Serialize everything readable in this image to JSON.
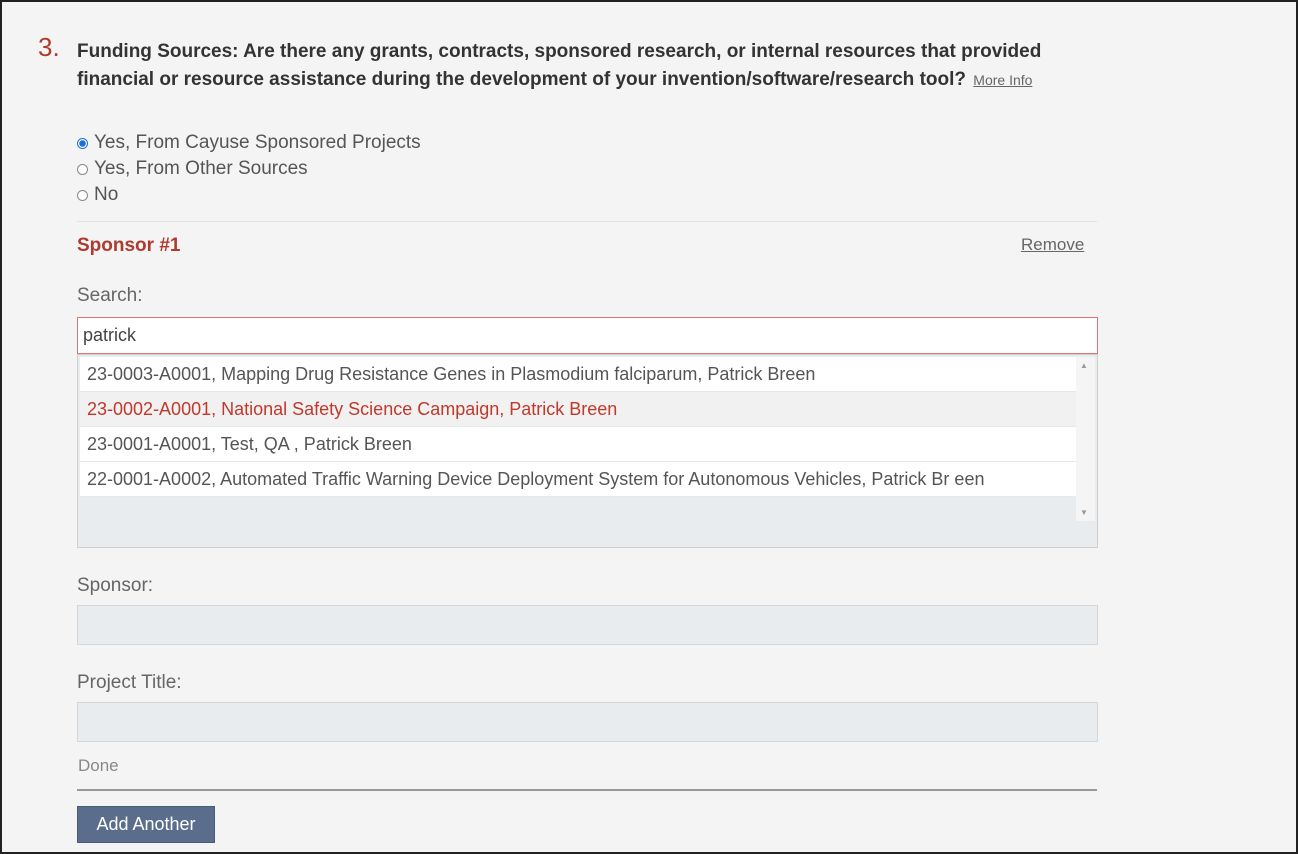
{
  "question": {
    "number": "3.",
    "text": "Funding Sources: Are there any grants, contracts, sponsored research, or internal resources that provided financial or resource assistance during the development of your invention/software/research tool?",
    "more_info": "More Info"
  },
  "options": [
    {
      "label": "Yes, From Cayuse Sponsored Projects",
      "checked": true
    },
    {
      "label": "Yes, From Other Sources",
      "checked": false
    },
    {
      "label": "No",
      "checked": false
    }
  ],
  "sponsor": {
    "title": "Sponsor #1",
    "remove": "Remove",
    "search_label": "Search:",
    "search_value": "patrick",
    "results": [
      "23-0003-A0001, Mapping Drug Resistance Genes in Plasmodium falciparum, Patrick Breen",
      "23-0002-A0001, National Safety Science Campaign, Patrick Breen",
      "23-0001-A0001, Test, QA , Patrick Breen",
      "22-0001-A0002, Automated Traffic Warning Device Deployment System for Autonomous Vehicles, Patrick Br een"
    ],
    "sponsor_label": "Sponsor:",
    "project_title_label": "Project Title:",
    "done": "Done"
  },
  "add_another": "Add Another",
  "colors": {
    "accent_red": "#b03a2e",
    "button": "#5a6d8c",
    "radio_blue": "#1a6fd8"
  }
}
